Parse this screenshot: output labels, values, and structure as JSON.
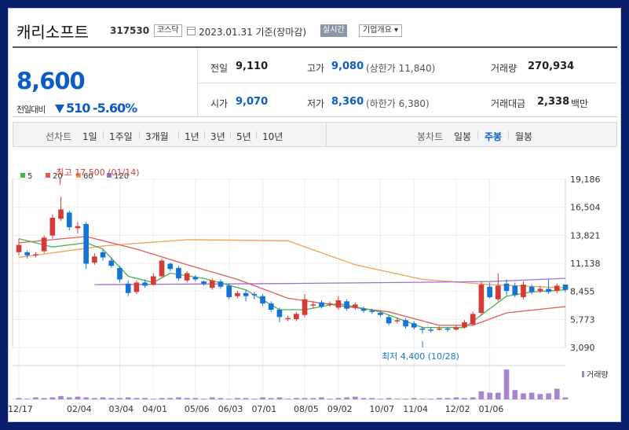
{
  "header": {
    "name": "캐리소프트",
    "code": "317530",
    "market": "코스닥",
    "date": "2023.01.31 기준(장마감)",
    "realtime": "실시간",
    "company_info": "기업개요 ▾"
  },
  "price": {
    "current": "8,600",
    "prev_label": "전일대비",
    "change": "510",
    "change_rate": "-5.60%",
    "prev_close": {
      "label": "전일",
      "value": "9,110"
    },
    "open": {
      "label": "시가",
      "value": "9,070"
    },
    "high": {
      "label": "고가",
      "value": "9,080",
      "limit": "(상한가 11,840)"
    },
    "low": {
      "label": "저가",
      "value": "8,360",
      "limit": "(하한가 6,380)"
    },
    "volume": {
      "label": "거래량",
      "value": "270,934"
    },
    "amount": {
      "label": "거래대금",
      "value": "2,338",
      "unit": "백만"
    }
  },
  "nav": {
    "line_chart": "선차트",
    "periods": [
      "1일",
      "1주일",
      "3개월",
      "1년",
      "3년",
      "5년",
      "10년"
    ],
    "candle_chart": "봉차트",
    "candle_periods": [
      "일봉",
      "주봉",
      "월봉"
    ],
    "active_candle": "주봉"
  },
  "colors": {
    "up": "#d63a36",
    "down": "#1473d6",
    "ma5": "#4caf50",
    "ma20": "#e05a5a",
    "ma60": "#f0a050",
    "ma120": "#a070d0",
    "volume": "#a884cf"
  },
  "chart_data": {
    "type": "candlestick",
    "legend": [
      "5",
      "20",
      "60",
      "120"
    ],
    "y_ticks": [
      "19,186",
      "16,504",
      "13,821",
      "11,138",
      "8,455",
      "5,773",
      "3,090"
    ],
    "ylim": [
      3090,
      19186
    ],
    "x_ticks": [
      "12/17",
      "02/04",
      "03/04",
      "04/01",
      "05/06",
      "06/03",
      "07/01",
      "08/05",
      "09/02",
      "10/07",
      "11/04",
      "12/02",
      "01/06"
    ],
    "high_annotation": "최고 17,500 (01/14)",
    "low_annotation": "최저 4,400 (10/28)",
    "volume_label": "거래량",
    "candles": [
      {
        "o": 12200,
        "c": 12900,
        "h": 13500,
        "l": 11900
      },
      {
        "o": 12200,
        "c": 11900,
        "h": 12400,
        "l": 11600
      },
      {
        "o": 12000,
        "c": 12000,
        "h": 12200,
        "l": 11700
      },
      {
        "o": 12300,
        "c": 13600,
        "h": 13800,
        "l": 12100
      },
      {
        "o": 13800,
        "c": 15500,
        "h": 15800,
        "l": 13500
      },
      {
        "o": 15400,
        "c": 16300,
        "h": 17500,
        "l": 15200
      },
      {
        "o": 16000,
        "c": 14600,
        "h": 16200,
        "l": 14300
      },
      {
        "o": 14500,
        "c": 14700,
        "h": 15100,
        "l": 14000
      },
      {
        "o": 14900,
        "c": 11100,
        "h": 15100,
        "l": 10600
      },
      {
        "o": 11200,
        "c": 11800,
        "h": 12100,
        "l": 11000
      },
      {
        "o": 12200,
        "c": 11700,
        "h": 12500,
        "l": 11400
      },
      {
        "o": 11400,
        "c": 10900,
        "h": 11700,
        "l": 10700
      },
      {
        "o": 10700,
        "c": 9600,
        "h": 10900,
        "l": 9300
      },
      {
        "o": 9200,
        "c": 8300,
        "h": 9500,
        "l": 8000
      },
      {
        "o": 8400,
        "c": 9300,
        "h": 9500,
        "l": 8200
      },
      {
        "o": 9300,
        "c": 9000,
        "h": 9600,
        "l": 8800
      },
      {
        "o": 9100,
        "c": 9900,
        "h": 10200,
        "l": 9000
      },
      {
        "o": 9900,
        "c": 11400,
        "h": 11600,
        "l": 9800
      },
      {
        "o": 11100,
        "c": 10600,
        "h": 11200,
        "l": 10400
      },
      {
        "o": 10700,
        "c": 9700,
        "h": 10900,
        "l": 9500
      },
      {
        "o": 9500,
        "c": 10200,
        "h": 10400,
        "l": 9300
      },
      {
        "o": 9800,
        "c": 9600,
        "h": 10000,
        "l": 9400
      },
      {
        "o": 9400,
        "c": 9200,
        "h": 9500,
        "l": 9000
      },
      {
        "o": 8800,
        "c": 9500,
        "h": 9700,
        "l": 8600
      },
      {
        "o": 9400,
        "c": 8900,
        "h": 9600,
        "l": 8700
      },
      {
        "o": 9000,
        "c": 7900,
        "h": 9200,
        "l": 7700
      },
      {
        "o": 8000,
        "c": 8300,
        "h": 8500,
        "l": 7800
      },
      {
        "o": 8300,
        "c": 8000,
        "h": 8600,
        "l": 7500
      },
      {
        "o": 8200,
        "c": 8100,
        "h": 8400,
        "l": 7700
      },
      {
        "o": 8000,
        "c": 7300,
        "h": 8200,
        "l": 7100
      },
      {
        "o": 7300,
        "c": 6700,
        "h": 7500,
        "l": 6500
      },
      {
        "o": 6700,
        "c": 6000,
        "h": 6900,
        "l": 5500
      },
      {
        "o": 5900,
        "c": 5900,
        "h": 6100,
        "l": 5600
      },
      {
        "o": 5800,
        "c": 6300,
        "h": 6500,
        "l": 5600
      },
      {
        "o": 6200,
        "c": 7700,
        "h": 8200,
        "l": 6000
      },
      {
        "o": 7100,
        "c": 7200,
        "h": 7500,
        "l": 6800
      },
      {
        "o": 7400,
        "c": 7000,
        "h": 7600,
        "l": 6800
      },
      {
        "o": 7200,
        "c": 7300,
        "h": 7500,
        "l": 7000
      },
      {
        "o": 6900,
        "c": 7600,
        "h": 8000,
        "l": 6700
      },
      {
        "o": 7500,
        "c": 6800,
        "h": 7700,
        "l": 6600
      },
      {
        "o": 6900,
        "c": 7200,
        "h": 7400,
        "l": 6700
      },
      {
        "o": 6800,
        "c": 6600,
        "h": 7000,
        "l": 6400
      },
      {
        "o": 6600,
        "c": 6500,
        "h": 6800,
        "l": 6300
      },
      {
        "o": 6400,
        "c": 6200,
        "h": 6600,
        "l": 6000
      },
      {
        "o": 6000,
        "c": 5400,
        "h": 6200,
        "l": 5200
      },
      {
        "o": 5700,
        "c": 5700,
        "h": 5900,
        "l": 5400
      },
      {
        "o": 5700,
        "c": 5100,
        "h": 5900,
        "l": 4900
      },
      {
        "o": 5400,
        "c": 5000,
        "h": 5600,
        "l": 4800
      },
      {
        "o": 4900,
        "c": 4800,
        "h": 5100,
        "l": 4400
      },
      {
        "o": 4800,
        "c": 4700,
        "h": 5000,
        "l": 4500
      },
      {
        "o": 4800,
        "c": 4900,
        "h": 5100,
        "l": 4700
      },
      {
        "o": 4900,
        "c": 4800,
        "h": 5000,
        "l": 4600
      },
      {
        "o": 4800,
        "c": 5000,
        "h": 5200,
        "l": 4700
      },
      {
        "o": 5000,
        "c": 5500,
        "h": 5700,
        "l": 4900
      },
      {
        "o": 5300,
        "c": 6300,
        "h": 6500,
        "l": 5200
      },
      {
        "o": 6400,
        "c": 9100,
        "h": 9400,
        "l": 6200
      },
      {
        "o": 8900,
        "c": 7900,
        "h": 9300,
        "l": 7800
      },
      {
        "o": 7700,
        "c": 9000,
        "h": 10200,
        "l": 7500
      },
      {
        "o": 9200,
        "c": 8500,
        "h": 9600,
        "l": 8100
      },
      {
        "o": 9000,
        "c": 8100,
        "h": 9300,
        "l": 7900
      },
      {
        "o": 7900,
        "c": 9100,
        "h": 9400,
        "l": 7700
      },
      {
        "o": 8900,
        "c": 8400,
        "h": 9100,
        "l": 8200
      },
      {
        "o": 8500,
        "c": 8700,
        "h": 9000,
        "l": 8300
      },
      {
        "o": 8700,
        "c": 8400,
        "h": 9600,
        "l": 8200
      },
      {
        "o": 8500,
        "c": 9000,
        "h": 9200,
        "l": 8300
      },
      {
        "o": 9110,
        "c": 8600,
        "h": 9080,
        "l": 8360
      }
    ],
    "ma5": [
      [
        0,
        13500
      ],
      [
        4,
        12700
      ],
      [
        8,
        13100
      ],
      [
        10,
        12500
      ],
      [
        13,
        9900
      ],
      [
        16,
        9300
      ],
      [
        18,
        10200
      ],
      [
        22,
        9700
      ],
      [
        27,
        8600
      ],
      [
        31,
        6700
      ],
      [
        34,
        6700
      ],
      [
        38,
        7300
      ],
      [
        43,
        6500
      ],
      [
        48,
        5000
      ],
      [
        53,
        5000
      ],
      [
        55,
        6200
      ],
      [
        58,
        8000
      ],
      [
        61,
        8400
      ],
      [
        65,
        8600
      ]
    ],
    "ma20": [
      [
        0,
        13100
      ],
      [
        8,
        13700
      ],
      [
        14,
        12500
      ],
      [
        20,
        11000
      ],
      [
        26,
        9600
      ],
      [
        32,
        7800
      ],
      [
        38,
        7100
      ],
      [
        44,
        6500
      ],
      [
        50,
        5200
      ],
      [
        54,
        5200
      ],
      [
        58,
        6400
      ],
      [
        65,
        7000
      ]
    ],
    "ma60": [
      [
        0,
        11700
      ],
      [
        10,
        12800
      ],
      [
        20,
        13400
      ],
      [
        32,
        13300
      ],
      [
        40,
        11000
      ],
      [
        48,
        9600
      ],
      [
        56,
        9100
      ],
      [
        65,
        8800
      ]
    ],
    "ma120": [
      [
        9,
        9100
      ],
      [
        30,
        9200
      ],
      [
        45,
        9300
      ],
      [
        56,
        9400
      ],
      [
        65,
        9700
      ]
    ],
    "volumes": [
      2,
      1,
      3,
      2,
      3,
      5,
      3,
      4,
      3,
      2,
      3,
      2,
      2,
      3,
      2,
      2,
      1,
      2,
      2,
      3,
      2,
      2,
      1,
      3,
      2,
      1,
      2,
      2,
      1,
      3,
      2,
      3,
      1,
      2,
      2,
      2,
      3,
      1,
      2,
      3,
      4,
      2,
      2,
      1,
      2,
      1,
      1,
      2,
      1,
      1,
      2,
      2,
      3,
      2,
      3,
      12,
      10,
      10,
      45,
      14,
      9,
      10,
      8,
      9,
      16,
      3
    ]
  }
}
